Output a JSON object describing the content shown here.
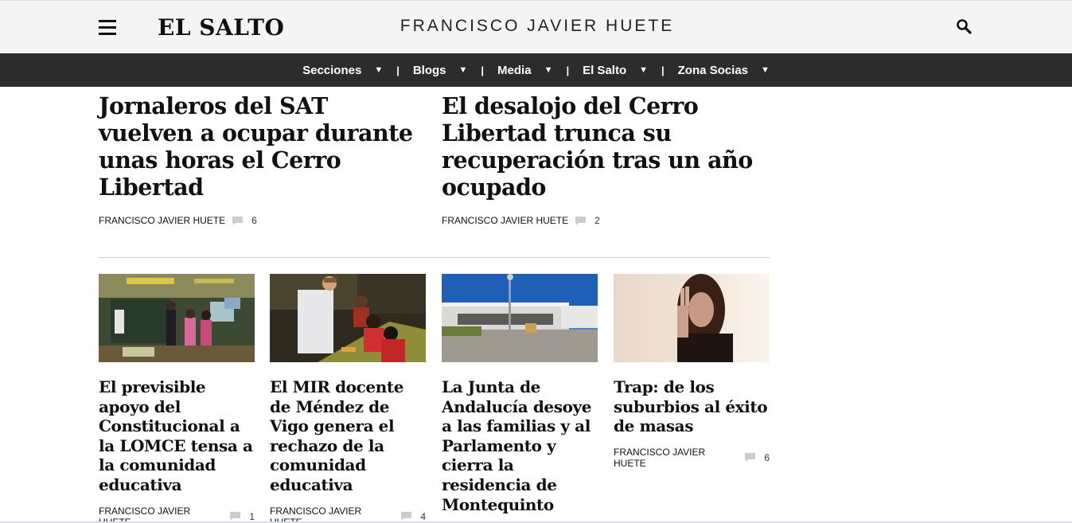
{
  "header": {
    "logo": "EL SALTO",
    "author_title": "FRANCISCO JAVIER HUETE"
  },
  "nav": {
    "items": [
      {
        "label": "Secciones"
      },
      {
        "label": "Blogs"
      },
      {
        "label": "Media"
      },
      {
        "label": "El Salto"
      },
      {
        "label": "Zona Socias"
      }
    ],
    "separator": "|",
    "caret": "▼"
  },
  "leads": [
    {
      "title": "Jornaleros del SAT vuelven a ocupar durante unas horas el Cerro Libertad",
      "author": "FRANCISCO JAVIER HUETE",
      "comments": "6"
    },
    {
      "title": "El desalojo del Cerro Libertad trunca su recuperación tras un año ocupado",
      "author": "FRANCISCO JAVIER HUETE",
      "comments": "2"
    }
  ],
  "cards": [
    {
      "title": "El previsible apoyo del Constitucional a la LOMCE tensa a la comunidad educativa",
      "author": "FRANCISCO JAVIER HUETE",
      "comments": "1",
      "image": "classroom-children-photo"
    },
    {
      "title": "El MIR docente de Méndez de Vigo genera el rechazo de la comunidad educativa",
      "author": "FRANCISCO JAVIER HUETE",
      "comments": "4",
      "image": "teacher-students-photo"
    },
    {
      "title": "La Junta de Andalucía desoye a las familias y al Parlamento y cierra la residencia de Montequinto",
      "author": "",
      "comments": "",
      "image": "residence-building-photo"
    },
    {
      "title": "Trap: de los suburbios al éxito de masas",
      "author": "FRANCISCO JAVIER HUETE",
      "comments": "6",
      "image": "woman-portrait-photo"
    }
  ],
  "colors": {
    "nav_bg": "#2c2c2c",
    "header_bg": "#f4f4f4",
    "comment_icon": "#cccccc"
  }
}
